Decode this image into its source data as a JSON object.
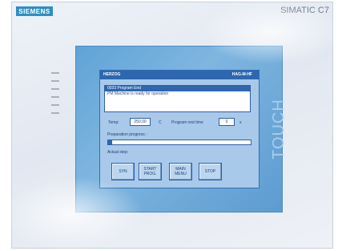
{
  "device": {
    "brand": "SIEMENS",
    "model": "SIMATIC C7",
    "side_label": "TOUCH",
    "led_labels": [
      "SF",
      "BF",
      "DC5V",
      "FRCE",
      "RUN",
      "STOP"
    ]
  },
  "screen": {
    "title_left": "HERZOG",
    "title_right": "HAG-M-HF",
    "messages": [
      {
        "text": "0033 Program End",
        "selected": true
      },
      {
        "text": "PM Machine is ready for operation",
        "selected": false
      }
    ],
    "temperature": {
      "label": "Temp:",
      "value": "250.00",
      "unit": "C"
    },
    "rest_time": {
      "label": "Program rest time",
      "value": "0",
      "unit": "s"
    },
    "progress": {
      "label": "Preparation progress :",
      "fraction": 0.03
    },
    "steps_label": "Actual step:",
    "buttons": [
      {
        "label": "SYN"
      },
      {
        "label": "START\nPROG."
      },
      {
        "label": "MAIN\nMENU"
      },
      {
        "label": "STOP"
      }
    ]
  },
  "colors": {
    "bezel": "#6aa8da",
    "screen_bg": "#a9c9ea",
    "title_bar": "#2e67b0",
    "brand": "#2c8fc4"
  }
}
